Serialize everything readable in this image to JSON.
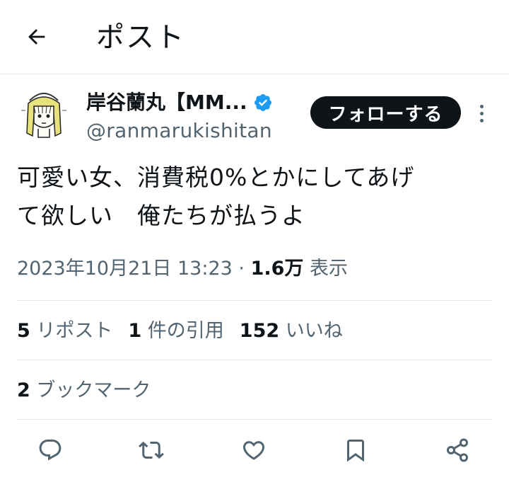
{
  "header": {
    "title": "ポスト",
    "back_icon": "arrow-left-icon"
  },
  "author": {
    "display_name": "岸谷蘭丸【MM...",
    "handle": "@ranmarukishitan",
    "verified_color": "#1d9bf0"
  },
  "follow_button": {
    "label": "フォローする"
  },
  "tweet": {
    "text_line1": "可愛い女、消費税0%とかにしてあげ",
    "text_line2": "て欲しい　俺たちが払うよ"
  },
  "meta": {
    "datetime": "2023年10月21日 13:23",
    "separator": " · ",
    "views_count": "1.6万",
    "views_label": "表示"
  },
  "stats": {
    "reposts_count": "5",
    "reposts_label": "リポスト",
    "quotes_count": "1",
    "quotes_label": "件の引用",
    "likes_count": "152",
    "likes_label": "いいね",
    "bookmarks_count": "2",
    "bookmarks_label": "ブックマーク"
  },
  "actions": [
    "reply-icon",
    "repost-icon",
    "like-icon",
    "bookmark-icon",
    "share-icon"
  ],
  "colors": {
    "text_primary": "#0f1419",
    "text_secondary": "#536471",
    "divider": "#e6e9eb"
  }
}
